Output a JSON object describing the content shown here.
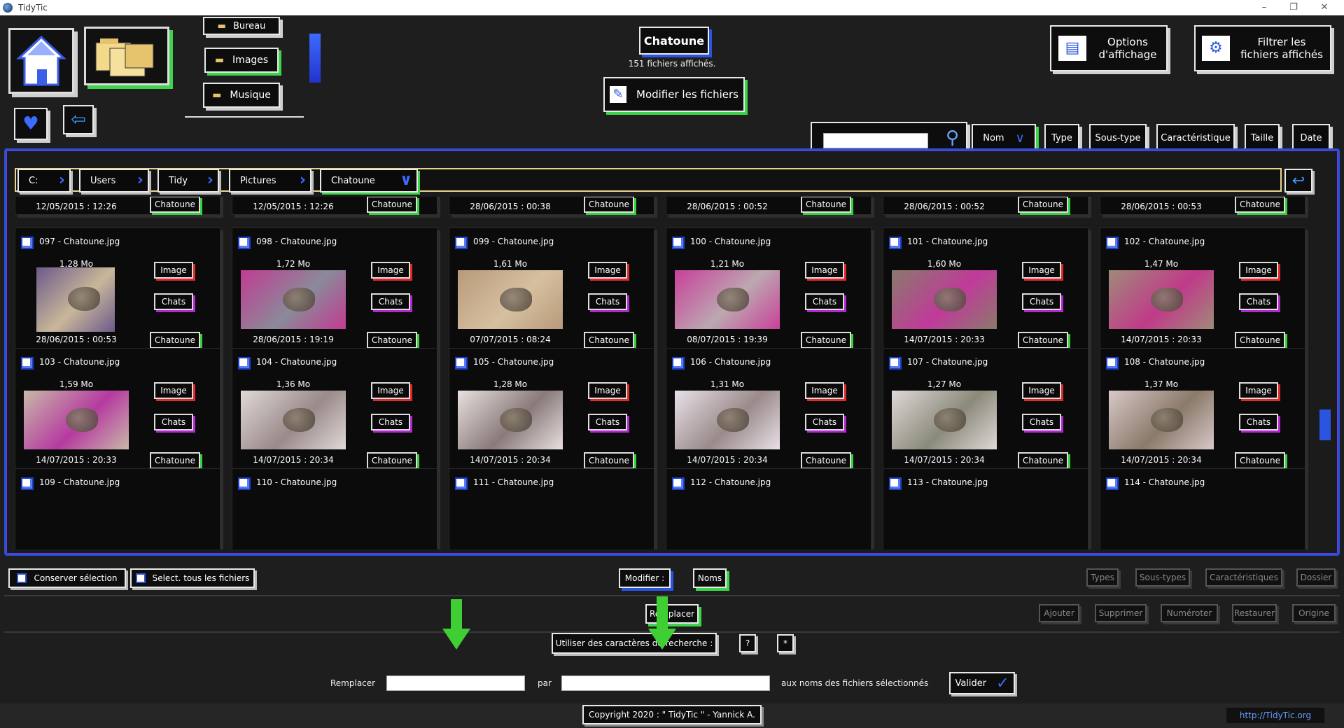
{
  "window": {
    "title": "TidyTic"
  },
  "nav": {
    "folders": [
      "Bureau",
      "Images",
      "Musique"
    ]
  },
  "header": {
    "folder_name": "Chatoune",
    "files_count": "151 fichiers affichés.",
    "modify_label": "Modifier les fichiers",
    "display_options": "Options d'affichage",
    "filter_label": "Filtrer les fichiers affichés"
  },
  "sort": {
    "search_placeholder": "",
    "buttons": [
      "Nom",
      "Type",
      "Sous-type",
      "Caractéristique",
      "Taille",
      "Date"
    ]
  },
  "breadcrumb": [
    "C:",
    "Users",
    "Tidy",
    "Pictures",
    "Chatoune"
  ],
  "top_row_dates": [
    "12/05/2015 : 12:26",
    "12/05/2015 : 12:26",
    "28/06/2015 : 00:38",
    "28/06/2015 : 00:52",
    "28/06/2015 : 00:52",
    "28/06/2015 : 00:53"
  ],
  "files": [
    {
      "name": "097 - Chatoune.jpg",
      "size": "1,28 Mo",
      "date": "28/06/2015 : 00:53",
      "type": "Image",
      "subtype": "Chats",
      "carac": "Chatoune"
    },
    {
      "name": "098 - Chatoune.jpg",
      "size": "1,72 Mo",
      "date": "28/06/2015 : 19:19",
      "type": "Image",
      "subtype": "Chats",
      "carac": "Chatoune"
    },
    {
      "name": "099 - Chatoune.jpg",
      "size": "1,61 Mo",
      "date": "07/07/2015 : 08:24",
      "type": "Image",
      "subtype": "Chats",
      "carac": "Chatoune"
    },
    {
      "name": "100 - Chatoune.jpg",
      "size": "1,21 Mo",
      "date": "08/07/2015 : 19:39",
      "type": "Image",
      "subtype": "Chats",
      "carac": "Chatoune"
    },
    {
      "name": "101 - Chatoune.jpg",
      "size": "1,60 Mo",
      "date": "14/07/2015 : 20:33",
      "type": "Image",
      "subtype": "Chats",
      "carac": "Chatoune"
    },
    {
      "name": "102 - Chatoune.jpg",
      "size": "1,47 Mo",
      "date": "14/07/2015 : 20:33",
      "type": "Image",
      "subtype": "Chats",
      "carac": "Chatoune"
    },
    {
      "name": "103 - Chatoune.jpg",
      "size": "1,59 Mo",
      "date": "14/07/2015 : 20:33",
      "type": "Image",
      "subtype": "Chats",
      "carac": "Chatoune"
    },
    {
      "name": "104 - Chatoune.jpg",
      "size": "1,36 Mo",
      "date": "14/07/2015 : 20:34",
      "type": "Image",
      "subtype": "Chats",
      "carac": "Chatoune"
    },
    {
      "name": "105 - Chatoune.jpg",
      "size": "1,28 Mo",
      "date": "14/07/2015 : 20:34",
      "type": "Image",
      "subtype": "Chats",
      "carac": "Chatoune"
    },
    {
      "name": "106 - Chatoune.jpg",
      "size": "1,31 Mo",
      "date": "14/07/2015 : 20:34",
      "type": "Image",
      "subtype": "Chats",
      "carac": "Chatoune"
    },
    {
      "name": "107 - Chatoune.jpg",
      "size": "1,27 Mo",
      "date": "14/07/2015 : 20:34",
      "type": "Image",
      "subtype": "Chats",
      "carac": "Chatoune"
    },
    {
      "name": "108 - Chatoune.jpg",
      "size": "1,37 Mo",
      "date": "14/07/2015 : 20:34",
      "type": "Image",
      "subtype": "Chats",
      "carac": "Chatoune"
    }
  ],
  "bottom_row_names": [
    "109 - Chatoune.jpg",
    "110 - Chatoune.jpg",
    "111 - Chatoune.jpg",
    "112 - Chatoune.jpg",
    "113 - Chatoune.jpg",
    "114 - Chatoune.jpg"
  ],
  "actions": {
    "keep_selection": "Conserver sélection",
    "select_all": "Select. tous les fichiers",
    "modify": "Modifier :",
    "noms": "Noms",
    "types": "Types",
    "sous_types": "Sous-types",
    "caracteristiques": "Caractéristiques",
    "dossier": "Dossier",
    "remplacer_btn": "Remplacer",
    "ajouter": "Ajouter",
    "supprimer": "Supprimer",
    "numeroter": "Numéroter",
    "restaurer": "Restaurer",
    "origine": "Origine",
    "wildcards": "Utiliser des caractères de recherche :",
    "wild_q": "?",
    "wild_star": "*",
    "replace_label": "Remplacer",
    "replace_value": "",
    "par_label": "par",
    "par_value": "",
    "suffix_label": "aux noms des fichiers sélectionnés",
    "valider": "Valider"
  },
  "footer": {
    "copyright": "Copyright 2020 : \" TidyTic \" - Yannick A.",
    "link": "http://TidyTic.org"
  },
  "colors": {
    "accent_blue": "#2b55e0",
    "accent_green": "#3dd34a",
    "type_red": "#e02a2a",
    "subtype_purple": "#b02ad0"
  }
}
